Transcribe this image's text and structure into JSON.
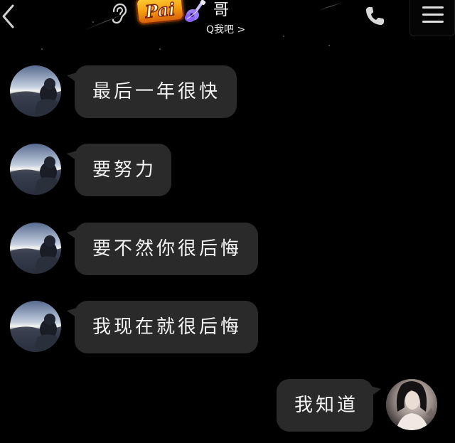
{
  "header": {
    "title": "哥",
    "subtitle": "Q我吧 >",
    "logo_text": "Pai",
    "icons": {
      "back": "chevron-left-icon",
      "ear": "ear-icon",
      "guitar": "guitar-icon",
      "phone": "phone-icon",
      "menu": "menu-icon"
    }
  },
  "messages": [
    {
      "side": "left",
      "text": "最后一年很快"
    },
    {
      "side": "left",
      "text": "要努力"
    },
    {
      "side": "left",
      "text": "要不然你很后悔"
    },
    {
      "side": "left",
      "text": "我现在就很后悔"
    },
    {
      "side": "right",
      "text": "我知道"
    }
  ],
  "colors": {
    "background": "#000000",
    "bubble": "#2a2a2a",
    "text": "#f4f4f4",
    "logo": "#f7a81b"
  }
}
